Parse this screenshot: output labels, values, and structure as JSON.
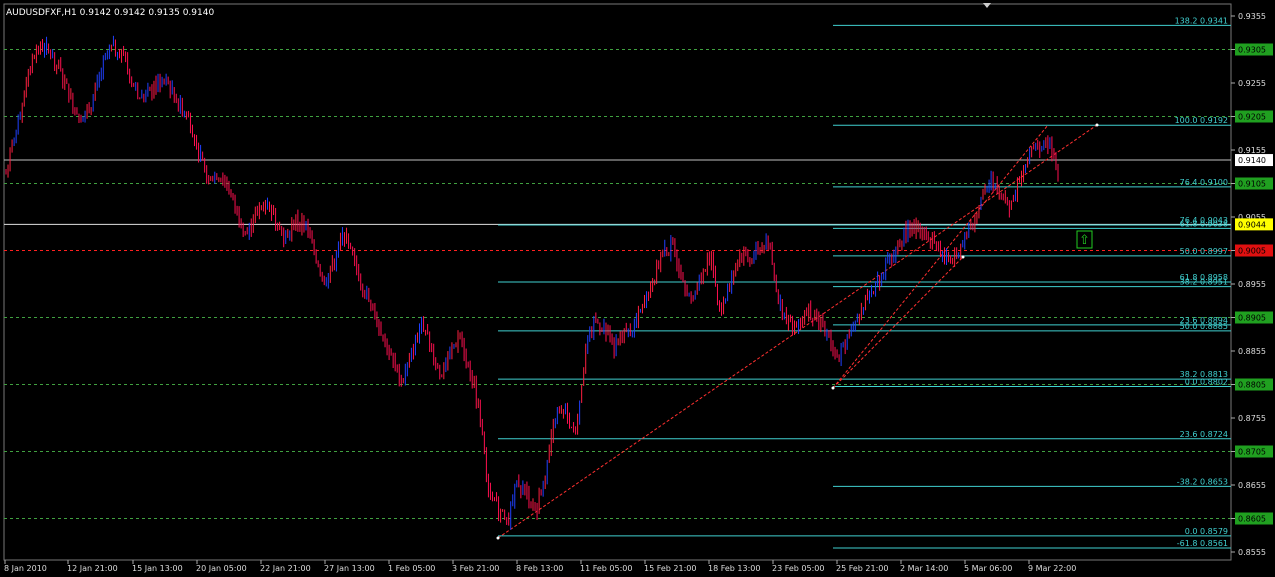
{
  "chart_data": {
    "type": "candlestick",
    "title": "AUDUSDFXF,H1  0.9142 0.9142 0.9135 0.9140",
    "price_range": [
      0.8549,
      0.937
    ],
    "y_ticks": [
      "0.9355",
      "0.9305",
      "0.9255",
      "0.9205",
      "0.9155",
      "0.9105",
      "0.9055",
      "0.9005",
      "0.8955",
      "0.8905",
      "0.8855",
      "0.8805",
      "0.8755",
      "0.8705",
      "0.8655",
      "0.8605",
      "0.8555"
    ],
    "y_tick_values": [
      0.9355,
      0.9305,
      0.9255,
      0.9205,
      0.9155,
      0.9105,
      0.9055,
      0.9005,
      0.8955,
      0.8905,
      0.8855,
      0.8805,
      0.8755,
      0.8705,
      0.8655,
      0.8605,
      0.8555
    ],
    "x_labels": [
      "8 Jan 2010",
      "12 Jan 21:00",
      "15 Jan 13:00",
      "20 Jan 05:00",
      "22 Jan 21:00",
      "27 Jan 13:00",
      "1 Feb 05:00",
      "3 Feb 21:00",
      "8 Feb 13:00",
      "11 Feb 05:00",
      "15 Feb 21:00",
      "18 Feb 13:00",
      "23 Feb 05:00",
      "25 Feb 21:00",
      "2 Mar 14:00",
      "5 Mar 06:00",
      "9 Mar 22:00"
    ],
    "current_price": {
      "label": "0.9140",
      "value": 0.914
    },
    "highlight_price": {
      "label": "0.9044",
      "value": 0.9044
    },
    "green_price_tags": [
      {
        "label": "0.9305",
        "value": 0.9305
      },
      {
        "label": "0.9205",
        "value": 0.9205
      },
      {
        "label": "0.9105",
        "value": 0.9105
      },
      {
        "label": "0.8905",
        "value": 0.8905
      },
      {
        "label": "0.8805",
        "value": 0.8805
      },
      {
        "label": "0.8705",
        "value": 0.8705
      },
      {
        "label": "0.8605",
        "value": 0.8605
      }
    ],
    "red_price_tag": {
      "label": "0.9005",
      "value": 0.9005
    },
    "dashed_levels": [
      0.9305,
      0.9205,
      0.9105,
      0.8905,
      0.8805,
      0.8705,
      0.8605
    ],
    "red_dashed_level": 0.9005,
    "fib_levels": [
      {
        "label": "138.2  0.9341",
        "value": 0.9341,
        "set": "right"
      },
      {
        "label": "100.0  0.9192",
        "value": 0.9192,
        "set": "right"
      },
      {
        "label": "76.4  0.9100",
        "value": 0.91,
        "set": "right"
      },
      {
        "label": "76.4  0.9043",
        "value": 0.9043,
        "set": "left"
      },
      {
        "label": "61.8  0.9038",
        "value": 0.9038,
        "set": "right"
      },
      {
        "label": "50.0  0.8997",
        "value": 0.8997,
        "set": "right"
      },
      {
        "label": "61.8  0.8958",
        "value": 0.8958,
        "set": "left"
      },
      {
        "label": "38.2  0.8951",
        "value": 0.8951,
        "set": "right"
      },
      {
        "label": "23.6  0.8894",
        "value": 0.8894,
        "set": "right"
      },
      {
        "label": "50.0  0.8885",
        "value": 0.8885,
        "set": "left"
      },
      {
        "label": "38.2  0.8813",
        "value": 0.8813,
        "set": "left"
      },
      {
        "label": "0.0  0.8802",
        "value": 0.8802,
        "set": "right"
      },
      {
        "label": "23.6  0.8724",
        "value": 0.8724,
        "set": "left"
      },
      {
        "label": "-38.2  0.8653",
        "value": 0.8653,
        "set": "right"
      },
      {
        "label": "0.0  0.8579",
        "value": 0.8579,
        "set": "left"
      },
      {
        "label": "-61.8  0.8561",
        "value": 0.8561,
        "set": "right"
      }
    ],
    "price_path": [
      0.912,
      0.918,
      0.925,
      0.93,
      0.931,
      0.929,
      0.926,
      0.922,
      0.92,
      0.923,
      0.928,
      0.931,
      0.93,
      0.926,
      0.923,
      0.924,
      0.926,
      0.925,
      0.922,
      0.92,
      0.915,
      0.911,
      0.912,
      0.91,
      0.906,
      0.903,
      0.906,
      0.908,
      0.905,
      0.902,
      0.905,
      0.904,
      0.9,
      0.896,
      0.899,
      0.903,
      0.899,
      0.895,
      0.892,
      0.888,
      0.884,
      0.881,
      0.885,
      0.89,
      0.886,
      0.882,
      0.885,
      0.888,
      0.883,
      0.877,
      0.864,
      0.862,
      0.86,
      0.866,
      0.864,
      0.862,
      0.868,
      0.876,
      0.876,
      0.873,
      0.885,
      0.89,
      0.889,
      0.886,
      0.888,
      0.889,
      0.892,
      0.896,
      0.9,
      0.901,
      0.897,
      0.893,
      0.896,
      0.9,
      0.891,
      0.896,
      0.9,
      0.899,
      0.901,
      0.902,
      0.893,
      0.89,
      0.889,
      0.892,
      0.89,
      0.888,
      0.884,
      0.887,
      0.89,
      0.893,
      0.895,
      0.898,
      0.9,
      0.903,
      0.904,
      0.904,
      0.902,
      0.9,
      0.899,
      0.901,
      0.904,
      0.908,
      0.911,
      0.909,
      0.907,
      0.911,
      0.915,
      0.916,
      0.917,
      0.912
    ]
  },
  "indicator": {
    "arrow_label": "⇧"
  }
}
